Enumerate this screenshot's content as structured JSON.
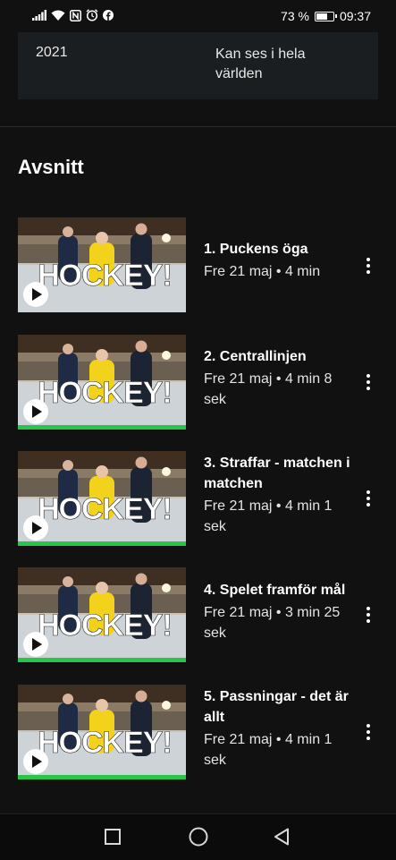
{
  "status_bar": {
    "battery_percent": "73 %",
    "battery_level": 0.73,
    "time": "09:37",
    "icons": [
      "signal-icon",
      "wifi-icon",
      "nfc-icon",
      "alarm-icon",
      "facebook-icon"
    ]
  },
  "info": {
    "year": "2021",
    "availability": "Kan ses i hela världen"
  },
  "section_title": "Avsnitt",
  "thumbnail_text": "HOCKEY!",
  "episodes": [
    {
      "title": "1. Puckens öga",
      "meta": "Fre 21 maj • 4 min",
      "progress": 0
    },
    {
      "title": "2. Centrallinjen",
      "meta": "Fre 21 maj • 4 min 8 sek",
      "progress": 1
    },
    {
      "title": "3. Straffar - matchen i matchen",
      "meta": "Fre 21 maj • 4 min 1 sek",
      "progress": 1
    },
    {
      "title": "4. Spelet framför mål",
      "meta": "Fre 21 maj • 3 min 25 sek",
      "progress": 1
    },
    {
      "title": "5. Passningar - det är allt",
      "meta": "Fre 21 maj • 4 min 1 sek",
      "progress": 1
    }
  ],
  "colors": {
    "background": "#111112",
    "card": "#1b1e20",
    "progress": "#27c64a",
    "thumb_jersey": "#f2d21b"
  },
  "nav": [
    "recents-square-icon",
    "home-circle-icon",
    "back-triangle-icon"
  ]
}
